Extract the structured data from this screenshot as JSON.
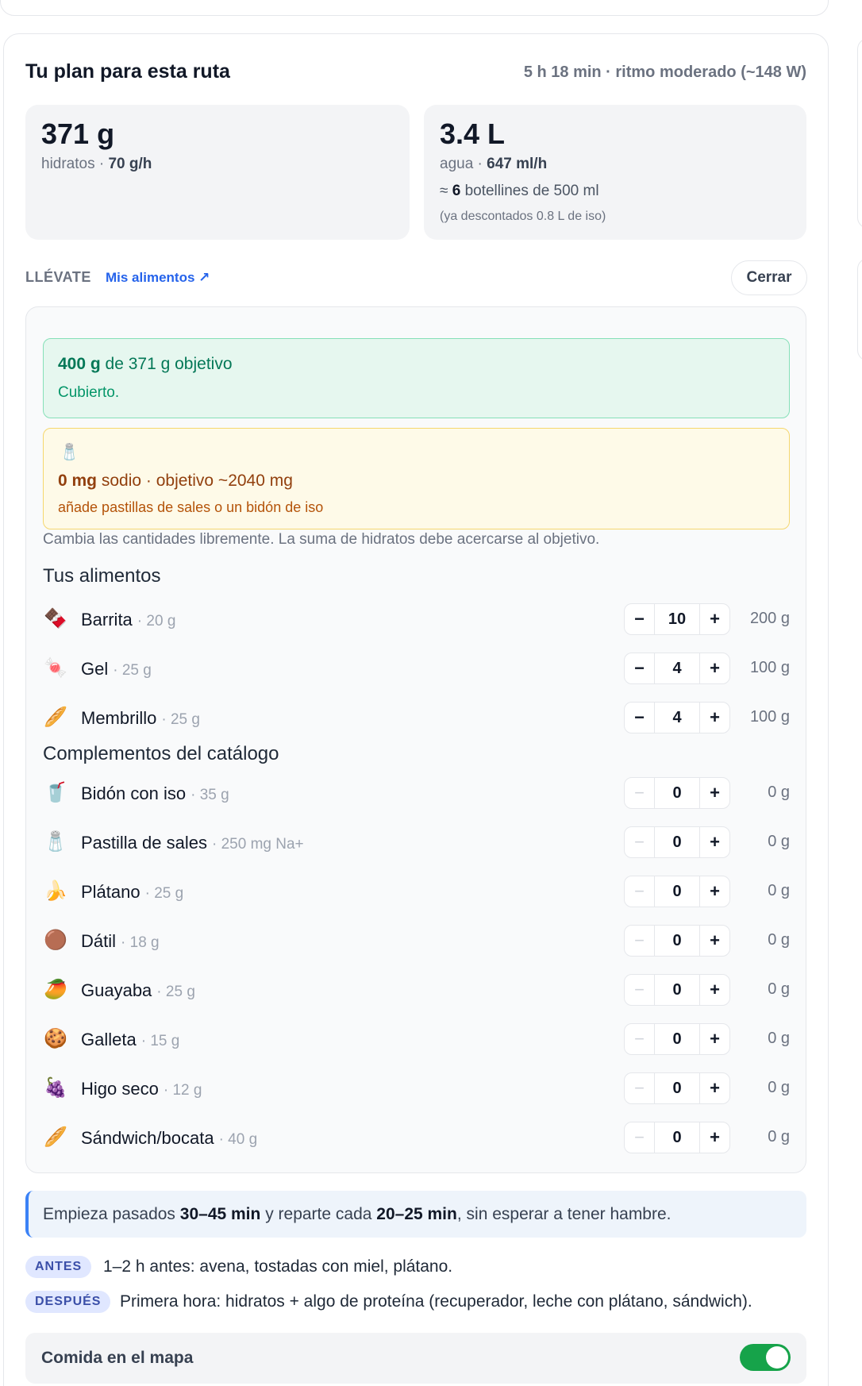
{
  "plan": {
    "title": "Tu plan para esta ruta",
    "meta": "5 h 18 min · ritmo moderado (~148 W)"
  },
  "stats": {
    "carbs": {
      "value": "371 g",
      "label": "hidratos · ",
      "rate": "70 g/h"
    },
    "water": {
      "value": "3.4 L",
      "label": "agua · ",
      "rate": "647 ml/h",
      "bottles_prefix": "≈ ",
      "bottles_count": "6",
      "bottles_suffix": " botellines de 500 ml",
      "note": "(ya descontados 0.8 L de iso)"
    }
  },
  "take": {
    "label": "LLÉVATE",
    "my_foods_link": "Mis alimentos ↗",
    "close_button": "Cerrar"
  },
  "coverage": {
    "amount": "400 g",
    "text": " de 371 g objetivo",
    "status": "Cubierto."
  },
  "sodium": {
    "icon": "salt-shaker-icon",
    "amount": "0 mg",
    "text": " sodio · objetivo ~2040 mg",
    "advice": "añade pastillas de sales o un bidón de iso"
  },
  "hint": "Cambia las cantidades libremente. La suma de hidratos debe acercarse al objetivo.",
  "my_foods": {
    "title": "Tus alimentos",
    "items": [
      {
        "icon": "chocolate-bar-icon",
        "glyph": "🍫",
        "name": "Barrita",
        "unit": "· 20 g",
        "qty": "10",
        "total": "200 g"
      },
      {
        "icon": "candy-icon",
        "glyph": "🍬",
        "name": "Gel",
        "unit": "· 25 g",
        "qty": "4",
        "total": "100 g"
      },
      {
        "icon": "baguette-icon",
        "glyph": "🥖",
        "name": "Membrillo",
        "unit": "· 25 g",
        "qty": "4",
        "total": "100 g"
      }
    ]
  },
  "catalog": {
    "title": "Complementos del catálogo",
    "items": [
      {
        "icon": "cup-with-straw-icon",
        "glyph": "🥤",
        "name": "Bidón con iso",
        "unit": "· 35 g",
        "qty": "0",
        "total": "0 g"
      },
      {
        "icon": "salt-shaker-icon",
        "glyph": "🧂",
        "name": "Pastilla de sales",
        "unit": "· 250 mg Na+",
        "qty": "0",
        "total": "0 g"
      },
      {
        "icon": "banana-icon",
        "glyph": "🍌",
        "name": "Plátano",
        "unit": "· 25 g",
        "qty": "0",
        "total": "0 g"
      },
      {
        "icon": "date-fruit-icon",
        "glyph": "🟤",
        "name": "Dátil",
        "unit": "· 18 g",
        "qty": "0",
        "total": "0 g"
      },
      {
        "icon": "mango-icon",
        "glyph": "🥭",
        "name": "Guayaba",
        "unit": "· 25 g",
        "qty": "0",
        "total": "0 g"
      },
      {
        "icon": "cookie-icon",
        "glyph": "🍪",
        "name": "Galleta",
        "unit": "· 15 g",
        "qty": "0",
        "total": "0 g"
      },
      {
        "icon": "grapes-icon",
        "glyph": "🍇",
        "name": "Higo seco",
        "unit": "· 12 g",
        "qty": "0",
        "total": "0 g"
      },
      {
        "icon": "baguette-icon",
        "glyph": "🥖",
        "name": "Sándwich/bocata",
        "unit": "· 40 g",
        "qty": "0",
        "total": "0 g"
      }
    ]
  },
  "tip": {
    "p1": "Empieza pasados ",
    "b1": "30–45 min",
    "p2": " y reparte cada ",
    "b2": "20–25 min",
    "p3": ", sin esperar a tener hambre."
  },
  "before": {
    "badge": "ANTES",
    "text": "1–2 h antes: avena, tostadas con miel, plátano."
  },
  "after": {
    "badge": "DESPUÉS",
    "text": "Primera hora: hidratos + algo de proteína (recuperador, leche con plátano, sándwich)."
  },
  "map_food": {
    "label": "Comida en el mapa",
    "enabled": true
  }
}
